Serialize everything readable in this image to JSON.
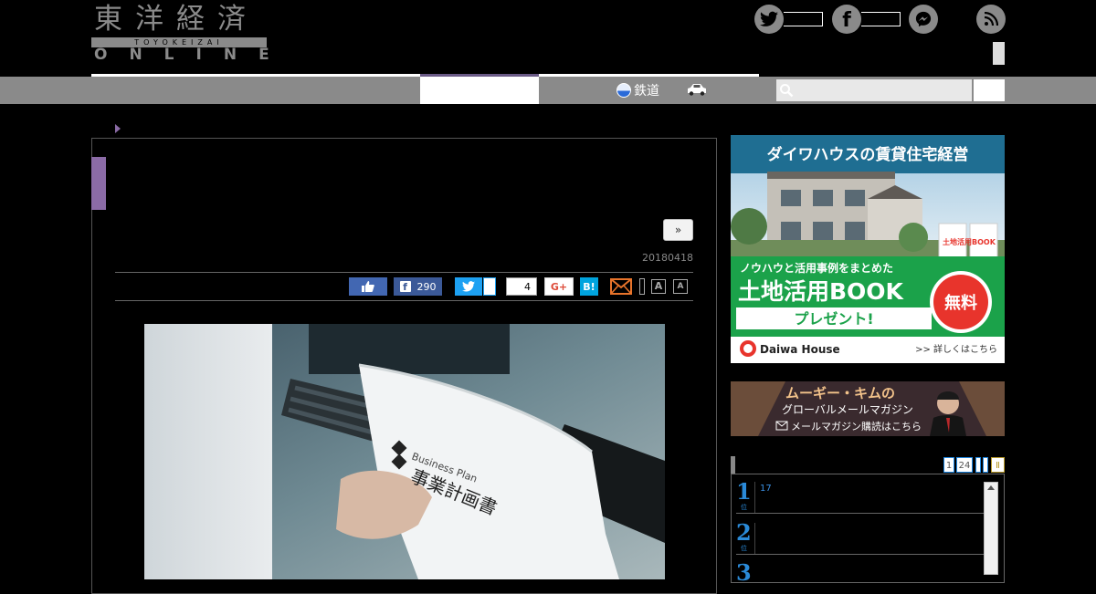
{
  "header": {
    "logo_kanji": "東洋経済",
    "logo_romaji": "TOYOKEIZAI",
    "logo_online": "ONLINE"
  },
  "nav": {
    "railway_label": "鉄道"
  },
  "article": {
    "next_label": "»",
    "date": "20180418",
    "share": {
      "facebook_count": "290",
      "pocket_count": "4",
      "gplus_label": "G+",
      "hatena_label": "B!",
      "font_large_label": "A",
      "font_small_label": "A"
    },
    "photo_text": {
      "brand": "Business Plan",
      "title": "事業計画書"
    }
  },
  "ads": {
    "daiwa": {
      "headline": "ダイワハウスの賃貸住宅経営",
      "subhead": "ノウハウと活用事例をまとめた",
      "main": "土地活用BOOK",
      "cta": "プレゼント!",
      "badge": "無料",
      "book_label": "土地活用BOOK",
      "brand": "Daiwa House",
      "more": ">> 詳しくはこちら"
    },
    "mail": {
      "name": "ムーギー・キムの",
      "title": "グローバルメールマガジン",
      "cta": "メールマガジン購読はこちら"
    }
  },
  "ranking": {
    "tabs": [
      "1",
      "24"
    ],
    "tab_end": "Ⅱ",
    "rank_suffix": "位",
    "items": [
      {
        "rank": "1",
        "text": "17"
      },
      {
        "rank": "2",
        "text": ""
      },
      {
        "rank": "3",
        "text": ""
      }
    ]
  },
  "colors": {
    "accent_purple": "#8b6ba6",
    "nav_gray": "#8a8a8a",
    "rank_blue": "#2a8ad8"
  }
}
